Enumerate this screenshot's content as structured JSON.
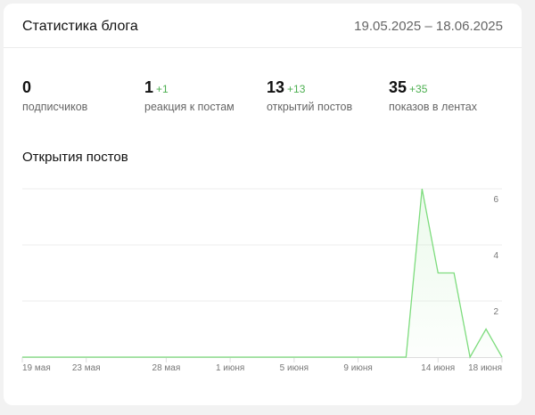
{
  "header": {
    "title": "Статистика блога",
    "date_range": "19.05.2025 – 18.06.2025"
  },
  "stats": [
    {
      "value": "0",
      "delta": "",
      "label": "подписчиков"
    },
    {
      "value": "1",
      "delta": "+1",
      "label": "реакция к постам"
    },
    {
      "value": "13",
      "delta": "+13",
      "label": "открытий постов"
    },
    {
      "value": "35",
      "delta": "+35",
      "label": "показов в лентах"
    }
  ],
  "chart_title": "Открытия постов",
  "chart_data": {
    "type": "area",
    "title": "Открытия постов",
    "x_days": 31,
    "x_start": "19 мая",
    "values": [
      0,
      0,
      0,
      0,
      0,
      0,
      0,
      0,
      0,
      0,
      0,
      0,
      0,
      0,
      0,
      0,
      0,
      0,
      0,
      0,
      0,
      0,
      0,
      0,
      0,
      6,
      3,
      3,
      0,
      1,
      0
    ],
    "x_ticks": [
      {
        "day": 0,
        "label": "19 мая"
      },
      {
        "day": 4,
        "label": "23 мая"
      },
      {
        "day": 9,
        "label": "28 мая"
      },
      {
        "day": 13,
        "label": "1 июня"
      },
      {
        "day": 17,
        "label": "5 июня"
      },
      {
        "day": 21,
        "label": "9 июня"
      },
      {
        "day": 26,
        "label": "14 июня"
      },
      {
        "day": 30,
        "label": "18 июня"
      }
    ],
    "y_ticks": [
      {
        "value": 2,
        "label": "2"
      },
      {
        "value": 4,
        "label": "4"
      },
      {
        "value": 6,
        "label": "6"
      }
    ],
    "ylim": [
      0,
      6
    ],
    "grid": true,
    "line_color": "#7ddc7d"
  }
}
